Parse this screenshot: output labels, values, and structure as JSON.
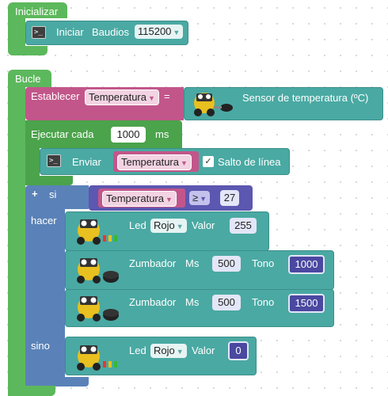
{
  "init": {
    "title": "Inicializar",
    "serial_label": "Iniciar",
    "baud_label": "Baudios",
    "baud_value": "115200"
  },
  "loop": {
    "title": "Bucle",
    "set_label": "Establecer",
    "set_var": "Temperatura",
    "equals": "=",
    "sensor_label": "Sensor de temperatura (ºC)",
    "every_label": "Ejecutar cada",
    "every_value": "1000",
    "every_unit": "ms",
    "send_label": "Enviar",
    "send_var": "Temperatura",
    "newline_label": "Salto de línea",
    "newline_checked": true
  },
  "if_block": {
    "if_label": "si",
    "plus": "+",
    "cond_var": "Temperatura",
    "cond_op": "≥",
    "cond_value": "27",
    "do_label": "hacer",
    "else_label": "sino"
  },
  "actions": {
    "led1": {
      "label": "Led",
      "color": "Rojo",
      "value_label": "Valor",
      "value": "255"
    },
    "buzz1": {
      "label": "Zumbador",
      "ms_label": "Ms",
      "ms": "500",
      "tone_label": "Tono",
      "tone": "1000"
    },
    "buzz2": {
      "label": "Zumbador",
      "ms_label": "Ms",
      "ms": "500",
      "tone_label": "Tono",
      "tone": "1500"
    },
    "led2": {
      "label": "Led",
      "color": "Rojo",
      "value_label": "Valor",
      "value": "0"
    }
  },
  "icons": {
    "terminal": "terminal-icon",
    "robot": "robot-board-icon",
    "dropdown": "chevron-down-icon"
  },
  "colors": {
    "event_green": "#5cb85c",
    "action_teal": "#4aa9a3",
    "variable_pink": "#c2568a",
    "logic_blue": "#5a82b8",
    "math_purple": "#5c57b0"
  }
}
